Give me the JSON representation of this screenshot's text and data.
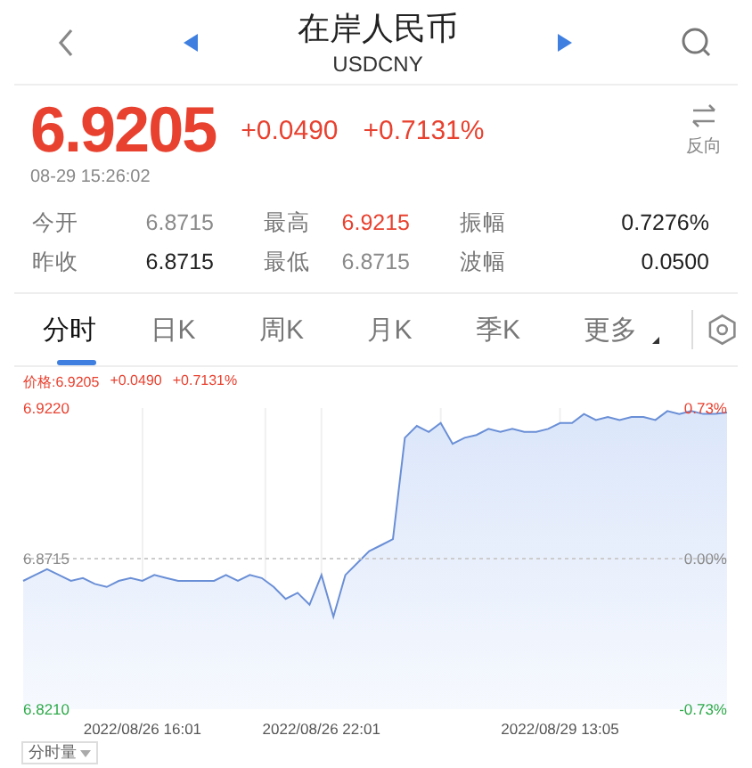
{
  "header": {
    "title": "在岸人民币",
    "subtitle": "USDCNY",
    "reverse_label": "反向"
  },
  "quote": {
    "price": "6.9205",
    "change": "+0.0490",
    "change_pct": "+0.7131%",
    "time": "08-29 15:26:02"
  },
  "stats": [
    {
      "label": "今开",
      "value": "6.8715",
      "color": "#8a8a8a"
    },
    {
      "label": "最高",
      "value": "6.9215",
      "color": "#e8412f"
    },
    {
      "label": "振幅",
      "value": "0.7276%",
      "color": "#222222"
    },
    {
      "label": "昨收",
      "value": "6.8715",
      "color": "#222222"
    },
    {
      "label": "最低",
      "value": "6.8715",
      "color": "#8a8a8a"
    },
    {
      "label": "波幅",
      "value": "0.0500",
      "color": "#222222"
    }
  ],
  "tabs": [
    {
      "label": "分时",
      "selected": true
    },
    {
      "label": "日K",
      "selected": false
    },
    {
      "label": "周K",
      "selected": false
    },
    {
      "label": "月K",
      "selected": false
    },
    {
      "label": "季K",
      "selected": false
    },
    {
      "label": "更多",
      "selected": false,
      "kind": "dropdown"
    }
  ],
  "chart": {
    "legend": [
      "价格:6.9205",
      "+0.0490",
      "+0.7131%"
    ],
    "right_axis": [
      {
        "text": "0.73%",
        "color": "#e8412f"
      },
      {
        "text": "0.00%",
        "color": "#8a8a8a"
      },
      {
        "text": "-0.73%",
        "color": "#2eaa4a"
      }
    ],
    "chart_data": {
      "type": "area",
      "categories": [
        null,
        null,
        null,
        null,
        null,
        null,
        null,
        null,
        null,
        null,
        "2022/08/26 16:01",
        null,
        null,
        null,
        null,
        null,
        null,
        null,
        null,
        null,
        null,
        null,
        null,
        null,
        null,
        "2022/08/26 22:01",
        null,
        null,
        null,
        null,
        null,
        null,
        null,
        null,
        null,
        null,
        null,
        null,
        null,
        null,
        null,
        null,
        null,
        null,
        null,
        "2022/08/29 13:05",
        null,
        null,
        null,
        null,
        null,
        null,
        null,
        null,
        null,
        null,
        null,
        null,
        null,
        null
      ],
      "grid": true,
      "ref_lines": [
        {
          "value": 6.8715,
          "axis": "y",
          "color": "#cccccc"
        }
      ],
      "series": [
        {
          "color": "#6a8fd6",
          "values": [
            6.864,
            6.866,
            6.868,
            6.866,
            6.864,
            6.865,
            6.863,
            6.862,
            6.864,
            6.865,
            6.864,
            6.866,
            6.865,
            6.864,
            6.864,
            6.864,
            6.864,
            6.866,
            6.864,
            6.866,
            6.865,
            6.862,
            6.858,
            6.86,
            6.856,
            6.866,
            6.852,
            6.866,
            6.87,
            6.874,
            6.876,
            6.878,
            6.912,
            6.916,
            6.914,
            6.917,
            6.91,
            6.912,
            6.913,
            6.915,
            6.914,
            6.915,
            6.914,
            6.914,
            6.915,
            6.917,
            6.917,
            6.92,
            6.918,
            6.919,
            6.918,
            6.919,
            6.919,
            6.918,
            6.921,
            6.92,
            6.921,
            6.92,
            6.92,
            6.9205
          ]
        }
      ],
      "ylim": [
        6.821,
        6.922
      ],
      "yticks": [
        {
          "value": 6.922,
          "label": "6.9220"
        },
        {
          "value": 6.8715,
          "label": "6.8715"
        },
        {
          "value": 6.821,
          "label": "6.8210"
        }
      ]
    }
  },
  "volume_button": "分时量"
}
